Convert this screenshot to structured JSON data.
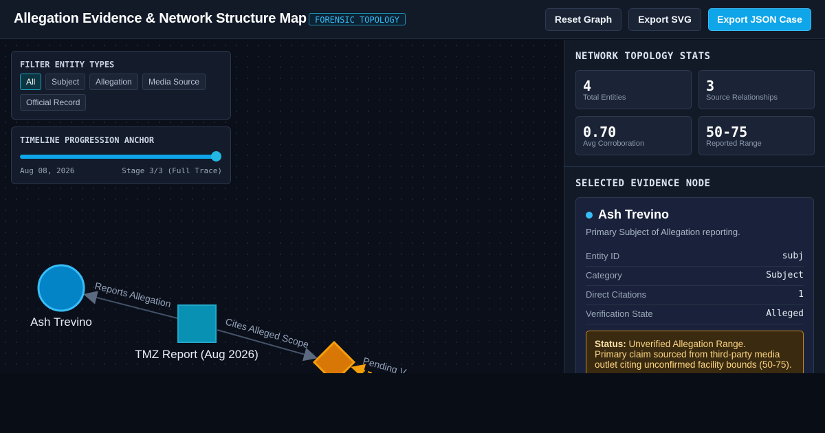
{
  "header": {
    "title": "Allegation Evidence & Network Structure Map",
    "badge": "FORENSIC TOPOLOGY",
    "buttons": {
      "reset": "Reset Graph",
      "export_svg": "Export SVG",
      "export_json": "Export JSON Case"
    }
  },
  "filters": {
    "title": "FILTER ENTITY TYPES",
    "chips": [
      "All",
      "Subject",
      "Allegation",
      "Media Source",
      "Official Record"
    ],
    "active": "All"
  },
  "timeline": {
    "title": "TIMELINE PROGRESSION ANCHOR",
    "date": "Aug 08, 2026",
    "stage": "Stage 3/3 (Full Trace)",
    "progress": 1.0
  },
  "graph": {
    "nodes": [
      {
        "label": "Ash Trevino",
        "shape": "circle",
        "color": "#0ea5e9"
      },
      {
        "label": "TMZ Report (Aug 2026)",
        "shape": "square",
        "color": "#0891b2"
      },
      {
        "label": "",
        "shape": "diamond",
        "color": "#d97706"
      }
    ],
    "edges": [
      {
        "label": "Reports Allegation"
      },
      {
        "label": "Cites Alleged Scope"
      },
      {
        "label": "Pending V"
      }
    ]
  },
  "stats": {
    "title": "NETWORK TOPOLOGY STATS",
    "items": [
      {
        "value": "4",
        "label": "Total Entities"
      },
      {
        "value": "3",
        "label": "Source Relationships"
      },
      {
        "value": "0.70",
        "label": "Avg Corroboration"
      },
      {
        "value": "50-75",
        "label": "Reported Range"
      }
    ]
  },
  "selected": {
    "title": "SELECTED EVIDENCE NODE",
    "name": "Ash Trevino",
    "description": "Primary Subject of Allegation reporting.",
    "rows": [
      {
        "key": "Entity ID",
        "value": "subj"
      },
      {
        "key": "Category",
        "value": "Subject"
      },
      {
        "key": "Direct Citations",
        "value": "1"
      },
      {
        "key": "Verification State",
        "value": "Alleged"
      }
    ],
    "status_label": "Status:",
    "status_headline": "Unverified Allegation Range.",
    "status_text": "Primary claim sourced from third-party media outlet citing unconfirmed facility bounds (50-75)."
  },
  "colors": {
    "accent": "#0ea5e9",
    "warning": "#d97706"
  }
}
